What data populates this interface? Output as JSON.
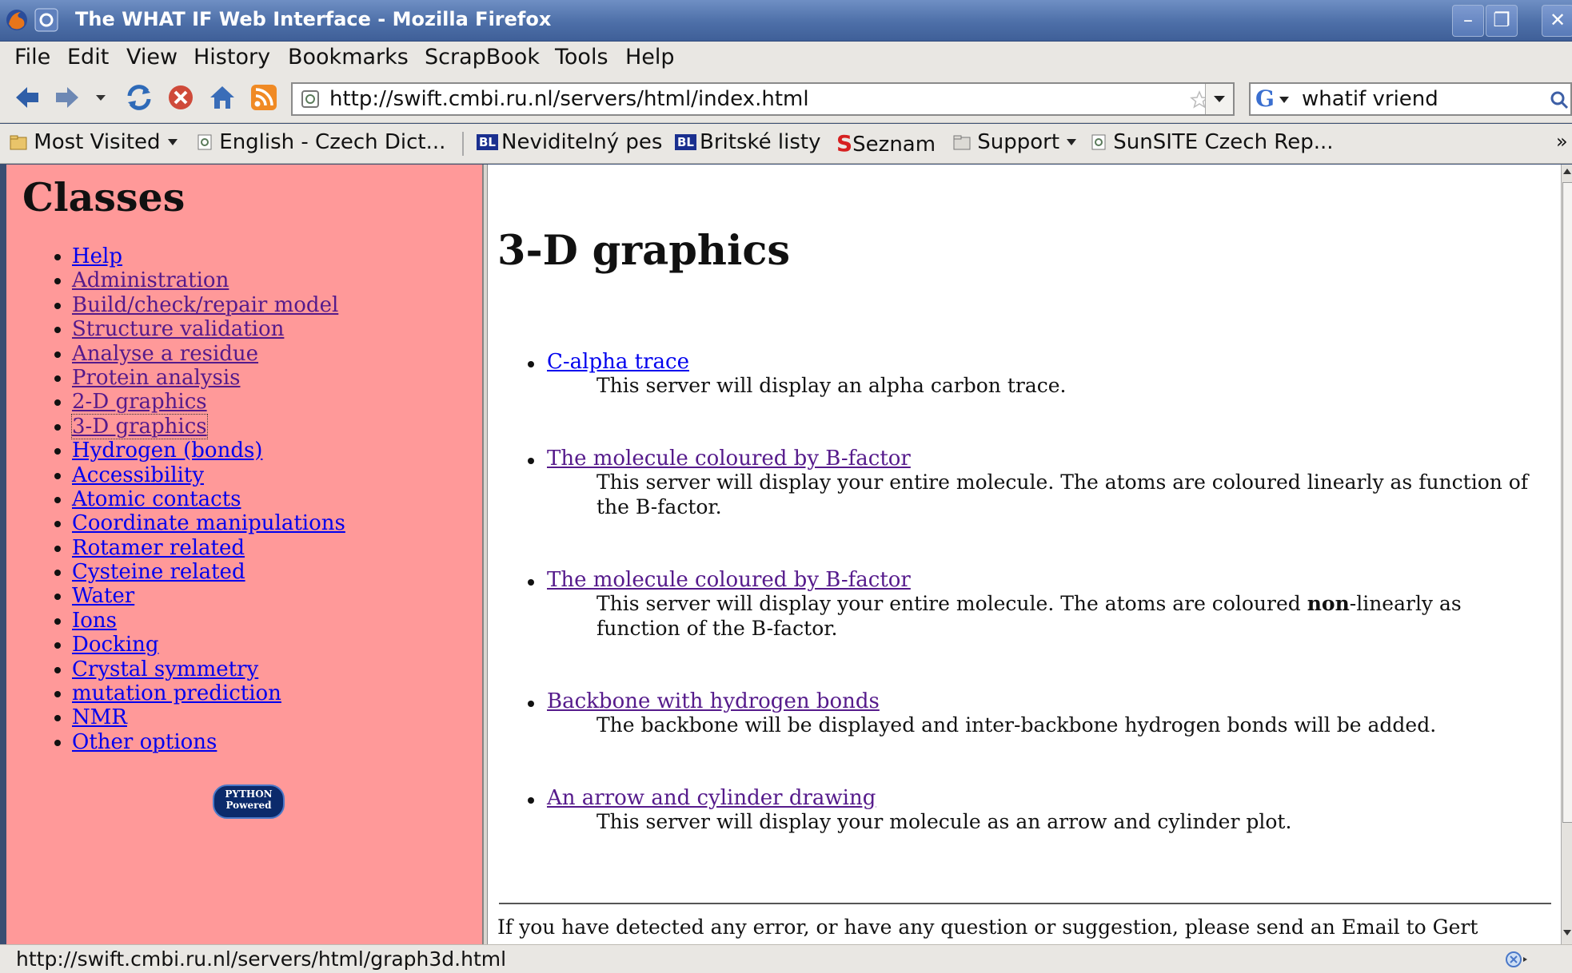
{
  "window": {
    "title": "The WHAT IF Web Interface - Mozilla Firefox",
    "minimize_glyph": "–",
    "maximize_glyph": "❐",
    "close_glyph": "✕"
  },
  "menu": [
    "File",
    "Edit",
    "View",
    "History",
    "Bookmarks",
    "ScrapBook",
    "Tools",
    "Help"
  ],
  "nav": {
    "url": "http://swift.cmbi.ru.nl/servers/html/index.html",
    "search_engine": "G",
    "search_query": "whatif vriend"
  },
  "bookmarks": {
    "items": [
      "Most Visited",
      "English - Czech Dict...",
      "Neviditelný pes",
      "Britské listy",
      "Seznam",
      "Support",
      "SunSITE Czech Rep..."
    ],
    "badge_text": "BL",
    "seznam_mark": "S",
    "overflow": "»"
  },
  "sidebar": {
    "heading": "Classes",
    "items": [
      "Help",
      "Administration",
      "Build/check/repair model",
      "Structure validation",
      "Analyse a residue",
      "Protein analysis",
      "2-D graphics",
      "3-D graphics",
      "Hydrogen (bonds)",
      "Accessibility",
      "Atomic contacts",
      "Coordinate manipulations",
      "Rotamer related",
      "Cysteine related",
      "Water",
      "Ions",
      "Docking",
      "Crystal symmetry",
      "mutation prediction",
      "NMR",
      "Other options"
    ],
    "badge_line1": "PYTHON",
    "badge_line2": "Powered"
  },
  "main": {
    "heading": "3-D graphics",
    "items": [
      {
        "link": "C-alpha trace",
        "desc": "This server will display an alpha carbon trace."
      },
      {
        "link": "The molecule coloured by B-factor",
        "desc": "This server will display your entire molecule. The atoms are coloured linearly as function of the B-factor."
      },
      {
        "link": "The molecule coloured by B-factor",
        "desc_before": "This server will display your entire molecule. The atoms are coloured ",
        "desc_bold": "non",
        "desc_after": "-linearly as function of the B-factor."
      },
      {
        "link": "Backbone with hydrogen bonds",
        "desc": "The backbone will be displayed and inter-backbone hydrogen bonds will be added."
      },
      {
        "link": "An arrow and cylinder drawing",
        "desc": "This server will display your molecule as an arrow and cylinder plot."
      }
    ],
    "footer": "If you have detected any error, or have any question or suggestion, please send an Email to Gert"
  },
  "status": {
    "text": "http://swift.cmbi.ru.nl/servers/html/graph3d.html"
  }
}
